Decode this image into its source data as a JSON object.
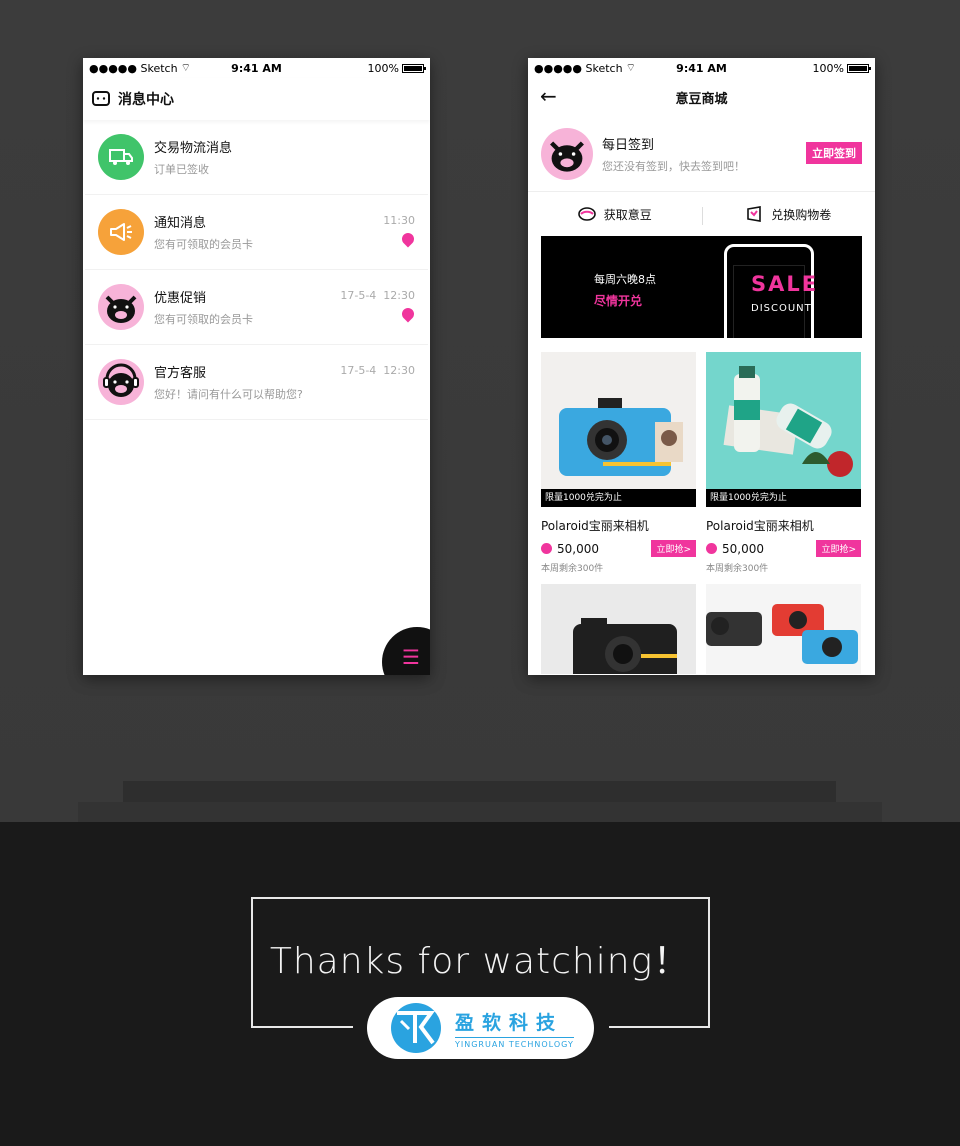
{
  "status_bar": {
    "carrier": "●●●●● Sketch",
    "time": "9:41 AM",
    "battery": "100%"
  },
  "message_center": {
    "title": "消息中心",
    "items": [
      {
        "title": "交易物流消息",
        "subtitle": "订单已签收",
        "date": "",
        "time": "",
        "unread": false,
        "icon": "truck-icon"
      },
      {
        "title": "通知消息",
        "subtitle": "您有可领取的会员卡",
        "date": "",
        "time": "11:30",
        "unread": true,
        "icon": "megaphone-icon"
      },
      {
        "title": "优惠促销",
        "subtitle": "您有可领取的会员卡",
        "date": "17-5-4",
        "time": "12:30",
        "unread": true,
        "icon": "pig-avatar-icon"
      },
      {
        "title": "官方客服",
        "subtitle": "您好！请问有什么可以帮助您?",
        "date": "17-5-4",
        "time": "12:30",
        "unread": false,
        "icon": "pig-headset-avatar-icon"
      }
    ],
    "fab_icon": "☰"
  },
  "shop": {
    "title": "意豆商城",
    "back_icon": "←",
    "checkin": {
      "title": "每日签到",
      "subtitle": "您还没有签到，快去签到吧！",
      "button": "立即签到"
    },
    "actions": [
      {
        "label": "获取意豆",
        "icon": "bean-icon"
      },
      {
        "label": "兑换购物卷",
        "icon": "coupon-icon"
      }
    ],
    "banner": {
      "line1": "每周六晚8点",
      "line2": "尽情开兑",
      "sale": "SALE",
      "discount": "DISCOUNT"
    },
    "products": [
      {
        "name": "Polaroid宝丽来相机",
        "tag": "限量1000兑完为止",
        "price": "50,000",
        "button": "立即抢>",
        "remain": "本周剩余300件"
      },
      {
        "name": "Polaroid宝丽来相机",
        "tag": "限量1000兑完为止",
        "price": "50,000",
        "button": "立即抢>",
        "remain": "本周剩余300件"
      }
    ]
  },
  "footer": {
    "thanks": "Thanks for watching！",
    "logo_cn": "盈软科技",
    "logo_en": "YINGRUAN TECHNOLOGY"
  },
  "colors": {
    "accent": "#f0359d",
    "green": "#40c46a",
    "orange": "#f6a23a",
    "brand_blue": "#2aa3e0"
  }
}
